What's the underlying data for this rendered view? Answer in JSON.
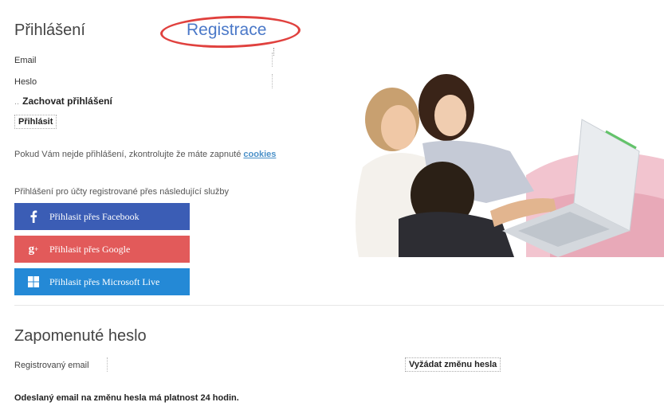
{
  "login": {
    "title": "Přihlášení",
    "register_link": "Registrace",
    "email_label": "Email",
    "password_label": "Heslo",
    "remember_prefix": "..",
    "remember_label": "Zachovat přihlášení",
    "submit_label": "Přihlásit",
    "hint_text": "Pokud Vám nejde přihlášení, zkontrolujte že máte zapnuté ",
    "hint_link": "cookies"
  },
  "services": {
    "heading": "Přihlášení pro účty registrované přes následující služby",
    "facebook_label": "Přihlasit přes Facebook",
    "google_label": "Přihlasit přes Google",
    "microsoft_label": "Přihlasit přes Microsoft Live"
  },
  "forgot": {
    "title": "Zapomenuté heslo",
    "email_label": "Registrovaný email",
    "submit_label": "Vyžádat změnu hesla",
    "note": "Odeslaný email na změnu hesla má platnost 24 hodin."
  },
  "colors": {
    "facebook": "#3b5db5",
    "google": "#e25a5a",
    "microsoft": "#2489d6",
    "register_highlight": "#e0413e",
    "link": "#4a78c8"
  },
  "icons": {
    "facebook": "facebook-icon",
    "google": "google-plus-icon",
    "microsoft": "windows-icon"
  }
}
